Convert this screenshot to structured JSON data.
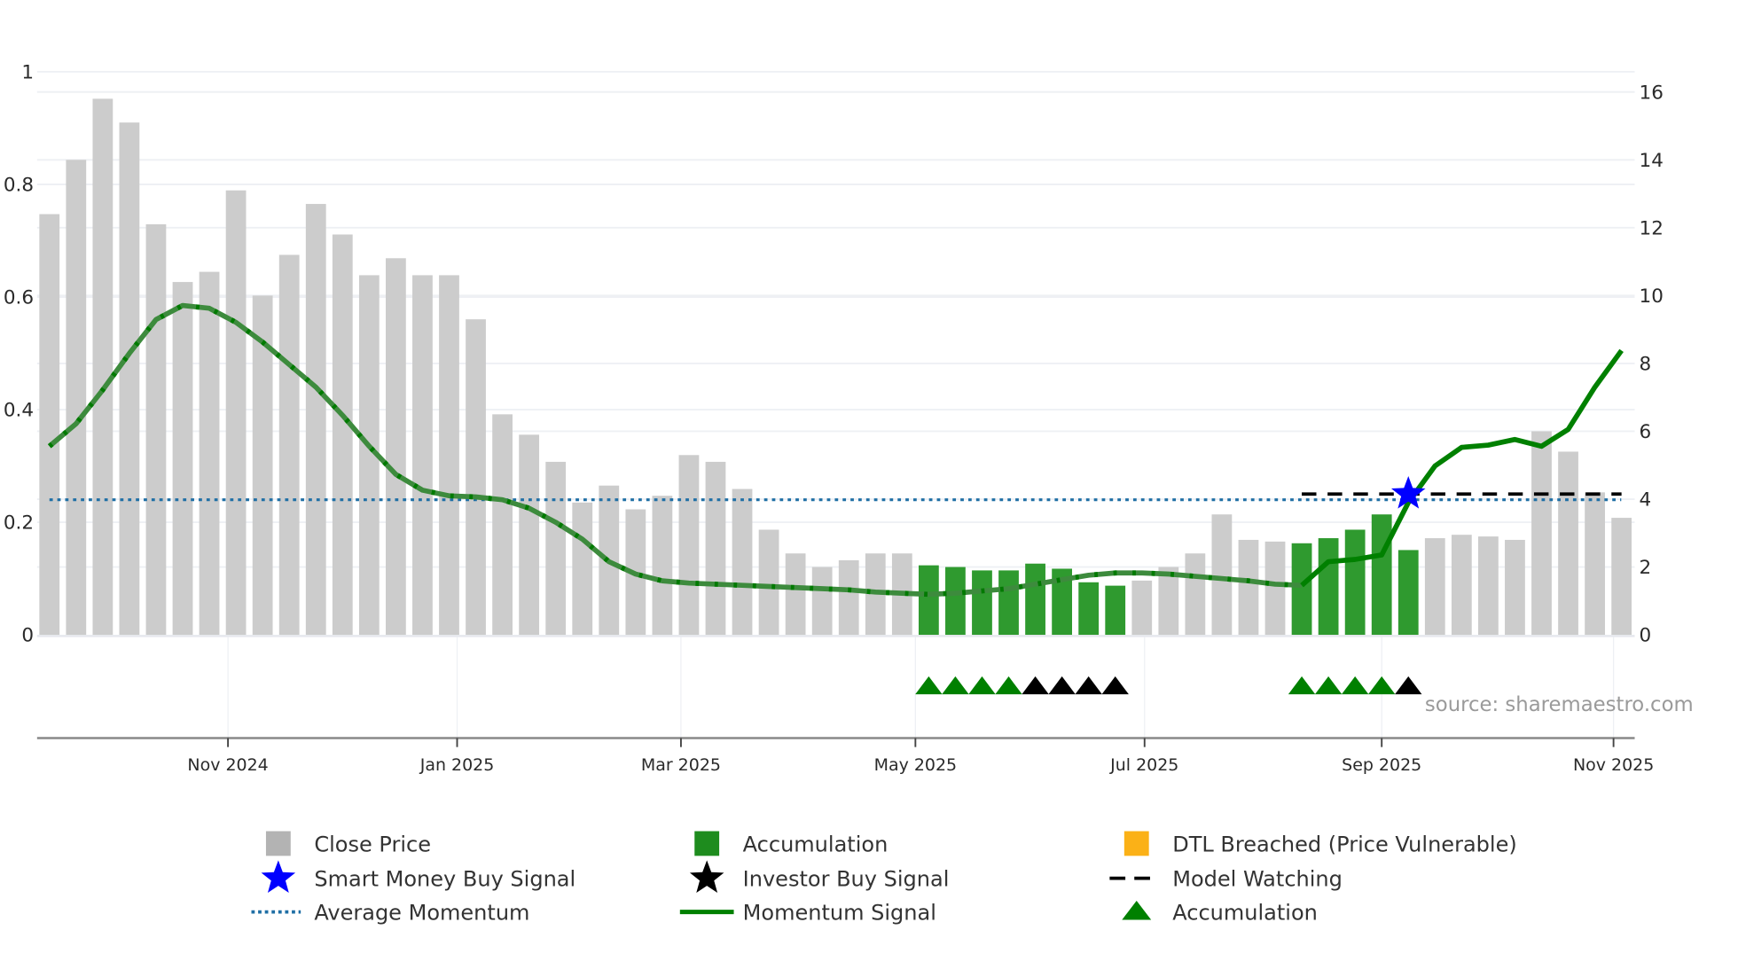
{
  "chart_data": {
    "type": "bar",
    "title": "",
    "source": "source: sharemaestro.com",
    "left_axis": {
      "ticks": [
        "0",
        "0.2",
        "0.4",
        "0.6",
        "0.8",
        "1"
      ],
      "values": [
        0,
        0.2,
        0.4,
        0.6,
        0.8,
        1
      ],
      "ylim": [
        0,
        1
      ]
    },
    "right_axis": {
      "ticks": [
        "0",
        "2",
        "4",
        "6",
        "8",
        "10",
        "12",
        "14",
        "16"
      ],
      "values": [
        0,
        2,
        4,
        6,
        8,
        10,
        12,
        14,
        16
      ],
      "ylim": [
        0,
        16
      ]
    },
    "x_ticks": [
      {
        "label": "Nov 2024",
        "bar_pos": 6.7
      },
      {
        "label": "Jan 2025",
        "bar_pos": 15.3
      },
      {
        "label": "Mar 2025",
        "bar_pos": 23.7
      },
      {
        "label": "May 2025",
        "bar_pos": 32.5
      },
      {
        "label": "Jul 2025",
        "bar_pos": 41.1
      },
      {
        "label": "Sep 2025",
        "bar_pos": 50.0
      },
      {
        "label": "Nov 2025",
        "bar_pos": 58.7
      }
    ],
    "close_price": [
      12.4,
      14.0,
      15.8,
      15.1,
      12.1,
      10.4,
      10.7,
      13.1,
      10.0,
      11.2,
      12.7,
      11.8,
      10.6,
      11.1,
      10.6,
      10.6,
      9.3,
      6.5,
      5.9,
      5.1,
      3.9,
      4.4,
      3.7,
      4.1,
      5.3,
      5.1,
      4.3,
      3.1,
      2.4,
      2.0,
      2.2,
      2.4,
      2.4,
      2.05,
      2.0,
      1.9,
      1.9,
      2.1,
      1.95,
      1.55,
      1.45,
      1.6,
      2.0,
      2.4,
      3.55,
      2.8,
      2.75,
      2.7,
      2.85,
      3.1,
      3.55,
      2.5,
      2.85,
      2.95,
      2.9,
      2.8,
      6.0,
      5.4,
      4.2,
      3.45
    ],
    "accumulation_bars": [
      33,
      34,
      35,
      36,
      37,
      38,
      39,
      40,
      47,
      48,
      49,
      50,
      51
    ],
    "momentum": [
      0.335,
      0.375,
      0.435,
      0.5,
      0.56,
      0.585,
      0.58,
      0.555,
      0.52,
      0.48,
      0.44,
      0.39,
      0.335,
      0.285,
      0.257,
      0.247,
      0.245,
      0.24,
      0.225,
      0.2,
      0.17,
      0.13,
      0.108,
      0.096,
      0.092,
      0.09,
      0.088,
      0.086,
      0.084,
      0.082,
      0.08,
      0.076,
      0.074,
      0.072,
      0.074,
      0.078,
      0.082,
      0.09,
      0.098,
      0.106,
      0.11,
      0.11,
      0.108,
      0.104,
      0.1,
      0.096,
      0.09,
      0.088,
      0.13,
      0.134,
      0.142,
      0.235,
      0.3,
      0.333,
      0.337,
      0.347,
      0.335,
      0.365,
      0.44,
      0.505
    ],
    "average_momentum": 0.24,
    "model_watching": {
      "level": 4.15,
      "from_bar": 47,
      "to_bar": 59
    },
    "smart_money_buy": [
      {
        "bar": 51,
        "price": 4.15
      }
    ],
    "accumulation_markers": [
      33,
      34,
      35,
      36,
      47,
      48,
      49,
      50
    ],
    "investor_markers": [
      37,
      38,
      39,
      40,
      51
    ],
    "colors": {
      "close": "#cccccc",
      "accumulation": "#2f9a2f",
      "dtl": "#fbb117",
      "momentum": "#008000",
      "avg": "#1f6fa5",
      "star": "#0000ff"
    },
    "legend": [
      {
        "label": "Close Price",
        "icon": "square-gray"
      },
      {
        "label": "Accumulation",
        "icon": "square-green"
      },
      {
        "label": "DTL Breached (Price Vulnerable)",
        "icon": "square-orange"
      },
      {
        "label": "Smart Money Buy Signal",
        "icon": "star-blue"
      },
      {
        "label": "Investor Buy Signal",
        "icon": "star-black"
      },
      {
        "label": "Model Watching",
        "icon": "dashed-black"
      },
      {
        "label": "Average Momentum",
        "icon": "dotted-blue"
      },
      {
        "label": "Momentum Signal",
        "icon": "line-green"
      },
      {
        "label": "Accumulation",
        "icon": "triangle-green"
      }
    ]
  }
}
